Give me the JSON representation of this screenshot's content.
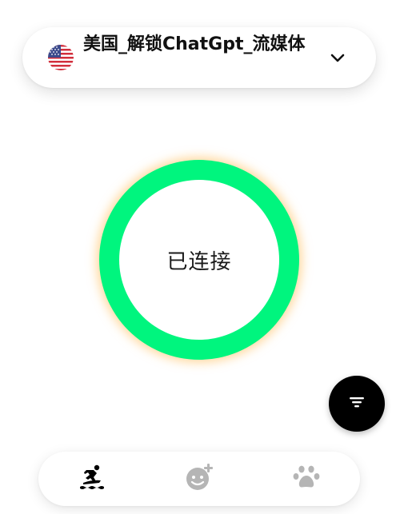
{
  "server": {
    "name": "美国_解锁ChatGpt_流媒体",
    "flag_icon": "us-flag-icon",
    "dropdown_icon": "chevron-down-icon"
  },
  "connection": {
    "status": "已连接",
    "ring_color": "#00f57e",
    "glow_color": "#ffbe5a"
  },
  "filter_button": {
    "icon": "filter-icon"
  },
  "bottom_nav": {
    "items": [
      {
        "icon": "surfing-icon",
        "active": true
      },
      {
        "icon": "face-add-icon",
        "active": false
      },
      {
        "icon": "paw-icon",
        "active": false
      }
    ],
    "active_color": "#000000",
    "inactive_color": "#b5b5b5"
  }
}
